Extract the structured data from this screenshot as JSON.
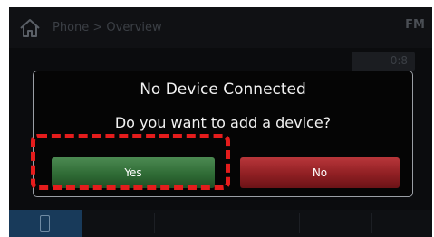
{
  "header": {
    "breadcrumb": "Phone > Overview",
    "source_badge": "FM"
  },
  "background_widget": {
    "label": "0:8"
  },
  "dialog": {
    "title": "No Device Connected",
    "message": "Do you want to add a device?",
    "yes_label": "Yes",
    "no_label": "No"
  },
  "icons": {
    "home": "home-icon",
    "phone": "phone-icon"
  },
  "colors": {
    "yes_button": "#2f6b35",
    "no_button": "#8f1f23",
    "highlight": "#e41c1c",
    "active_tab": "#183a5a"
  }
}
